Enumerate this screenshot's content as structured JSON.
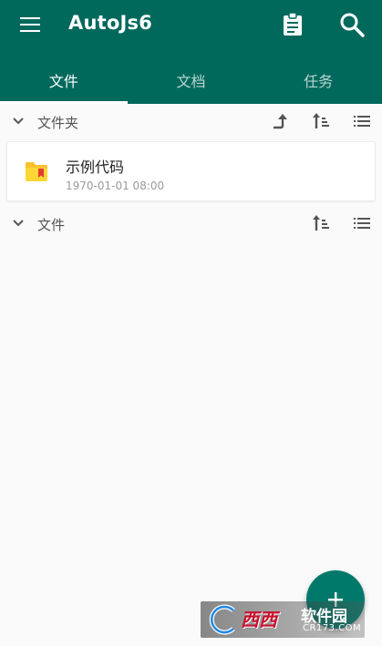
{
  "app": {
    "title": "AutoJs6"
  },
  "colors": {
    "primary": "#00695c",
    "accent": "#00796b",
    "folder": "#fbc02d"
  },
  "toolbar": {
    "icons": [
      "menu-icon",
      "clipboard-icon",
      "search-icon"
    ]
  },
  "tabs": [
    {
      "label": "文件",
      "active": true
    },
    {
      "label": "文档",
      "active": false
    },
    {
      "label": "任务",
      "active": false
    }
  ],
  "sections": {
    "folders": {
      "label": "文件夹",
      "icons": [
        "chevron-down-icon",
        "go-up-icon",
        "sort-icon",
        "list-view-icon"
      ]
    },
    "files": {
      "label": "文件",
      "icons": [
        "chevron-down-icon",
        "sort-icon",
        "list-view-icon"
      ]
    }
  },
  "folder_items": [
    {
      "name": "示例代码",
      "date": "1970-01-01 08:00"
    }
  ],
  "fab": {
    "icon": "plus-icon"
  },
  "watermark": {
    "text": "西西",
    "text2": "软件园",
    "url": "CR173.COM"
  }
}
